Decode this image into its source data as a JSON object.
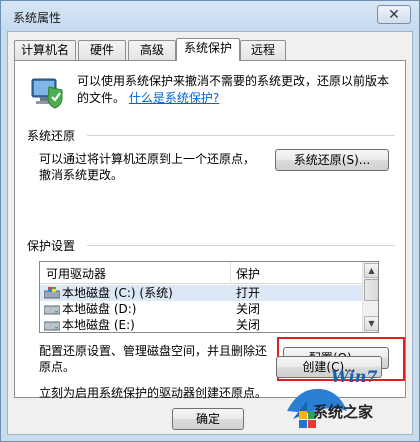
{
  "window": {
    "title": "系统属性",
    "close_glyph": "✕"
  },
  "tabs": [
    {
      "label": "计算机名",
      "active": false
    },
    {
      "label": "硬件",
      "active": false
    },
    {
      "label": "高级",
      "active": false
    },
    {
      "label": "系统保护",
      "active": true
    },
    {
      "label": "远程",
      "active": false
    }
  ],
  "intro": {
    "text": "可以使用系统保护来撤消不需要的系统更改，还原以前版本的文件。",
    "link": "什么是系统保护?"
  },
  "restore": {
    "section_title": "系统还原",
    "description_line1": "可以通过将计算机还原到上一个还原点，",
    "description_line2": "撤消系统更改。",
    "button_label": "系统还原(S)..."
  },
  "protection": {
    "section_title": "保护设置",
    "columns": [
      "可用驱动器",
      "保护"
    ],
    "drives": [
      {
        "name": "本地磁盘 (C:) (系统)",
        "protection": "打开",
        "icon": "windows-drive-icon",
        "selected": true
      },
      {
        "name": "本地磁盘 (D:)",
        "protection": "关闭",
        "icon": "hard-drive-icon",
        "selected": false
      },
      {
        "name": "本地磁盘 (E:)",
        "protection": "关闭",
        "icon": "hard-drive-icon",
        "selected": false
      }
    ],
    "configure_line1": "配置还原设置、管理磁盘空间，并且删除还",
    "configure_line2": "原点。",
    "configure_button": "配置(O)...",
    "create_text": "立刻为启用系统保护的驱动器创建还原点。",
    "create_button": "创建(C)..."
  },
  "footer": {
    "ok_button": "确定"
  },
  "watermark": {
    "line1": "Win7",
    "line2": "系统之家"
  },
  "colors": {
    "accent_highlight": "#e02020",
    "link": "#0066cc",
    "selection": "#dde8f6"
  }
}
